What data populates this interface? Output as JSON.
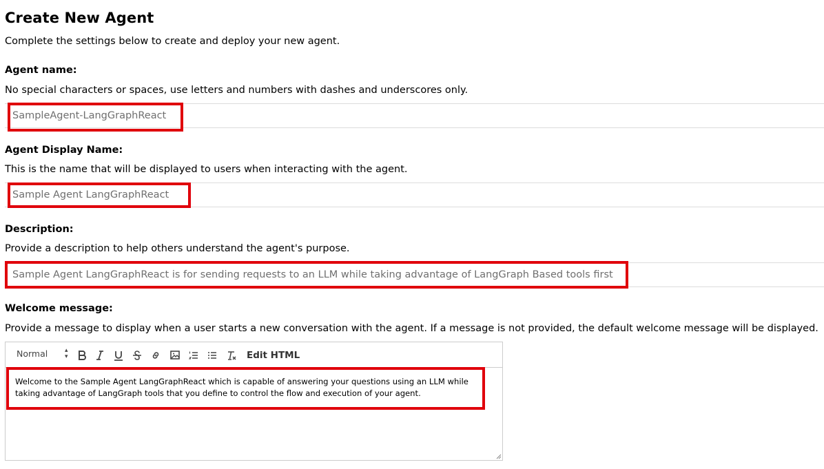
{
  "page": {
    "title": "Create New Agent",
    "subtitle": "Complete the settings below to create and deploy your new agent."
  },
  "fields": {
    "agent_name": {
      "label": "Agent name:",
      "help": "No special characters or spaces, use letters and numbers with dashes and underscores only.",
      "value": "SampleAgent-LangGraphReact"
    },
    "display_name": {
      "label": "Agent Display Name:",
      "help": "This is the name that will be displayed to users when interacting with the agent.",
      "value": "Sample Agent LangGraphReact"
    },
    "description": {
      "label": "Description:",
      "help": "Provide a description to help others understand the agent's purpose.",
      "value": "Sample Agent LangGraphReact is for sending requests to an LLM while taking advantage of LangGraph Based tools first"
    },
    "welcome_message": {
      "label": "Welcome message:",
      "help": "Provide a message to display when a user starts a new conversation with the agent. If a message is not provided, the default welcome message will be displayed.",
      "value": "Welcome to the Sample Agent LangGraphReact which is capable of answering your questions using an LLM while taking advantage of LangGraph tools that you define to control the flow and execution of your agent."
    }
  },
  "editor_toolbar": {
    "format_selected": "Normal",
    "tools": [
      "bold-icon",
      "italic-icon",
      "underline-icon",
      "strikethrough-icon",
      "link-icon",
      "image-icon",
      "ordered-list-icon",
      "bullet-list-icon",
      "clear-format-icon"
    ],
    "edit_html_label": "Edit HTML"
  },
  "colors": {
    "highlight": "#e0000b",
    "input_text": "#6f6f6f",
    "border": "#dcdcdc"
  }
}
